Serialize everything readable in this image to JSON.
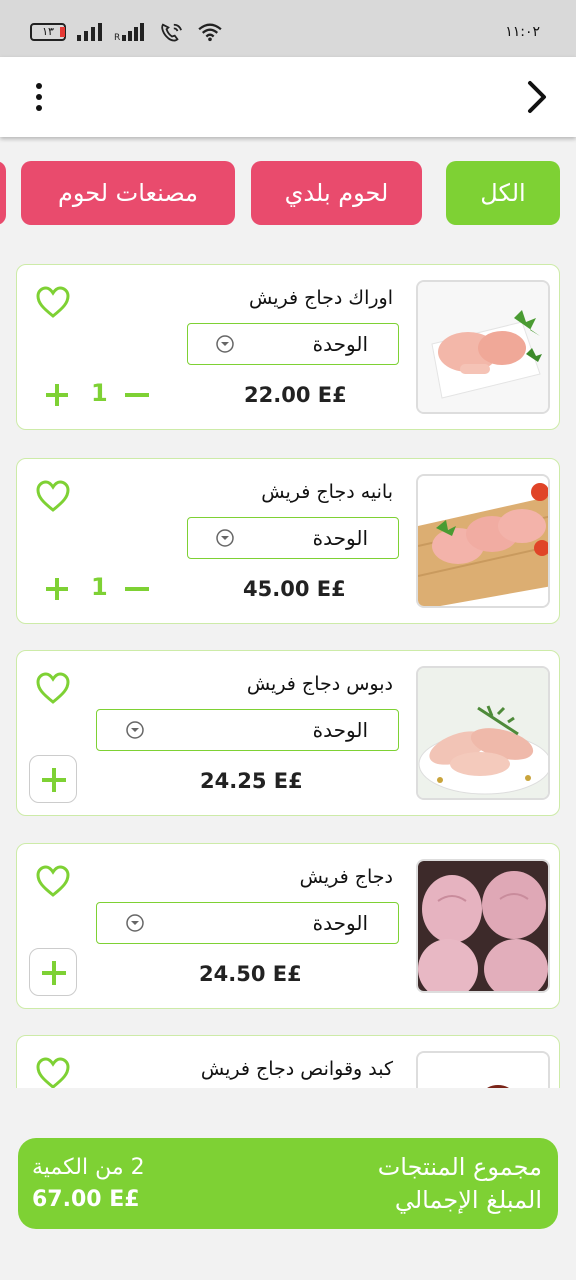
{
  "status_bar": {
    "battery": "١٣",
    "time": "١١:٠٢"
  },
  "colors": {
    "accent": "#7ed134",
    "pink": "#e94b6d"
  },
  "categories": [
    {
      "label": "الكل",
      "selected": true
    },
    {
      "label": "لحوم بلدي",
      "selected": false
    },
    {
      "label": "مصنعات لحوم",
      "selected": false
    }
  ],
  "products": [
    {
      "name": "اوراك دجاج فريش",
      "unit": "الوحدة",
      "price": "22.00 E£",
      "qty": "1",
      "in_cart": true,
      "image": "chicken-thighs-image"
    },
    {
      "name": "بانيه دجاج فريش",
      "unit": "الوحدة",
      "price": "45.00 E£",
      "qty": "1",
      "in_cart": true,
      "image": "chicken-breast-image"
    },
    {
      "name": "دبوس دجاج فريش",
      "unit": "الوحدة",
      "price": "24.25 E£",
      "in_cart": false,
      "image": "chicken-drumsticks-image"
    },
    {
      "name": "دجاج فريش",
      "unit": "الوحدة",
      "price": "24.50 E£",
      "in_cart": false,
      "image": "whole-chicken-image"
    },
    {
      "name": "كبد وقوانص دجاج فريش",
      "image": "chicken-liver-image"
    }
  ],
  "summary": {
    "products_label": "مجموع المنتجات",
    "total_label": "المبلغ الإجمالي",
    "quantity_text": "2 من الكمية",
    "total_value": "67.00 E£"
  }
}
